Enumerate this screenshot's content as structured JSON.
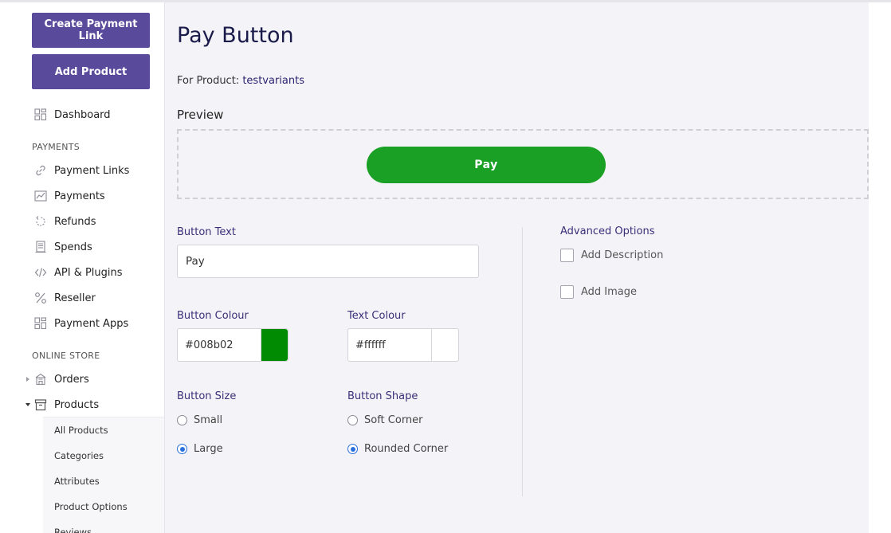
{
  "sidebar": {
    "create_payment_link": "Create Payment Link",
    "add_product": "Add Product",
    "dashboard": "Dashboard",
    "section_payments": "PAYMENTS",
    "items_payments": [
      {
        "label": "Payment Links",
        "icon": "link-icon"
      },
      {
        "label": "Payments",
        "icon": "chart-icon"
      },
      {
        "label": "Refunds",
        "icon": "refund-icon"
      },
      {
        "label": "Spends",
        "icon": "receipt-icon"
      },
      {
        "label": "API & Plugins",
        "icon": "code-icon"
      },
      {
        "label": "Reseller",
        "icon": "percent-icon"
      },
      {
        "label": "Payment Apps",
        "icon": "apps-icon"
      }
    ],
    "section_store": "ONLINE STORE",
    "orders": "Orders",
    "products": "Products",
    "product_subitems": [
      "All Products",
      "Categories",
      "Attributes",
      "Product Options",
      "Reviews"
    ]
  },
  "main": {
    "title": "Pay Button",
    "for_product_label": "For Product:",
    "product_name": "testvariants",
    "preview_label": "Preview",
    "preview_button_text": "Pay",
    "button_text_label": "Button Text",
    "button_text_value": "Pay",
    "button_colour_label": "Button Colour",
    "button_colour_value": "#008b02",
    "text_colour_label": "Text Colour",
    "text_colour_value": "#ffffff",
    "button_size_label": "Button Size",
    "size_options": [
      "Small",
      "Large"
    ],
    "size_selected": "Large",
    "button_shape_label": "Button Shape",
    "shape_options": [
      "Soft Corner",
      "Rounded Corner"
    ],
    "shape_selected": "Rounded Corner",
    "advanced_label": "Advanced Options",
    "advanced_options": [
      "Add Description",
      "Add Image"
    ]
  },
  "colors": {
    "brand": "#5a4a9c",
    "preview_button_bg": "#1aa025",
    "swatch_button": "#008b02",
    "swatch_text": "#ffffff"
  }
}
